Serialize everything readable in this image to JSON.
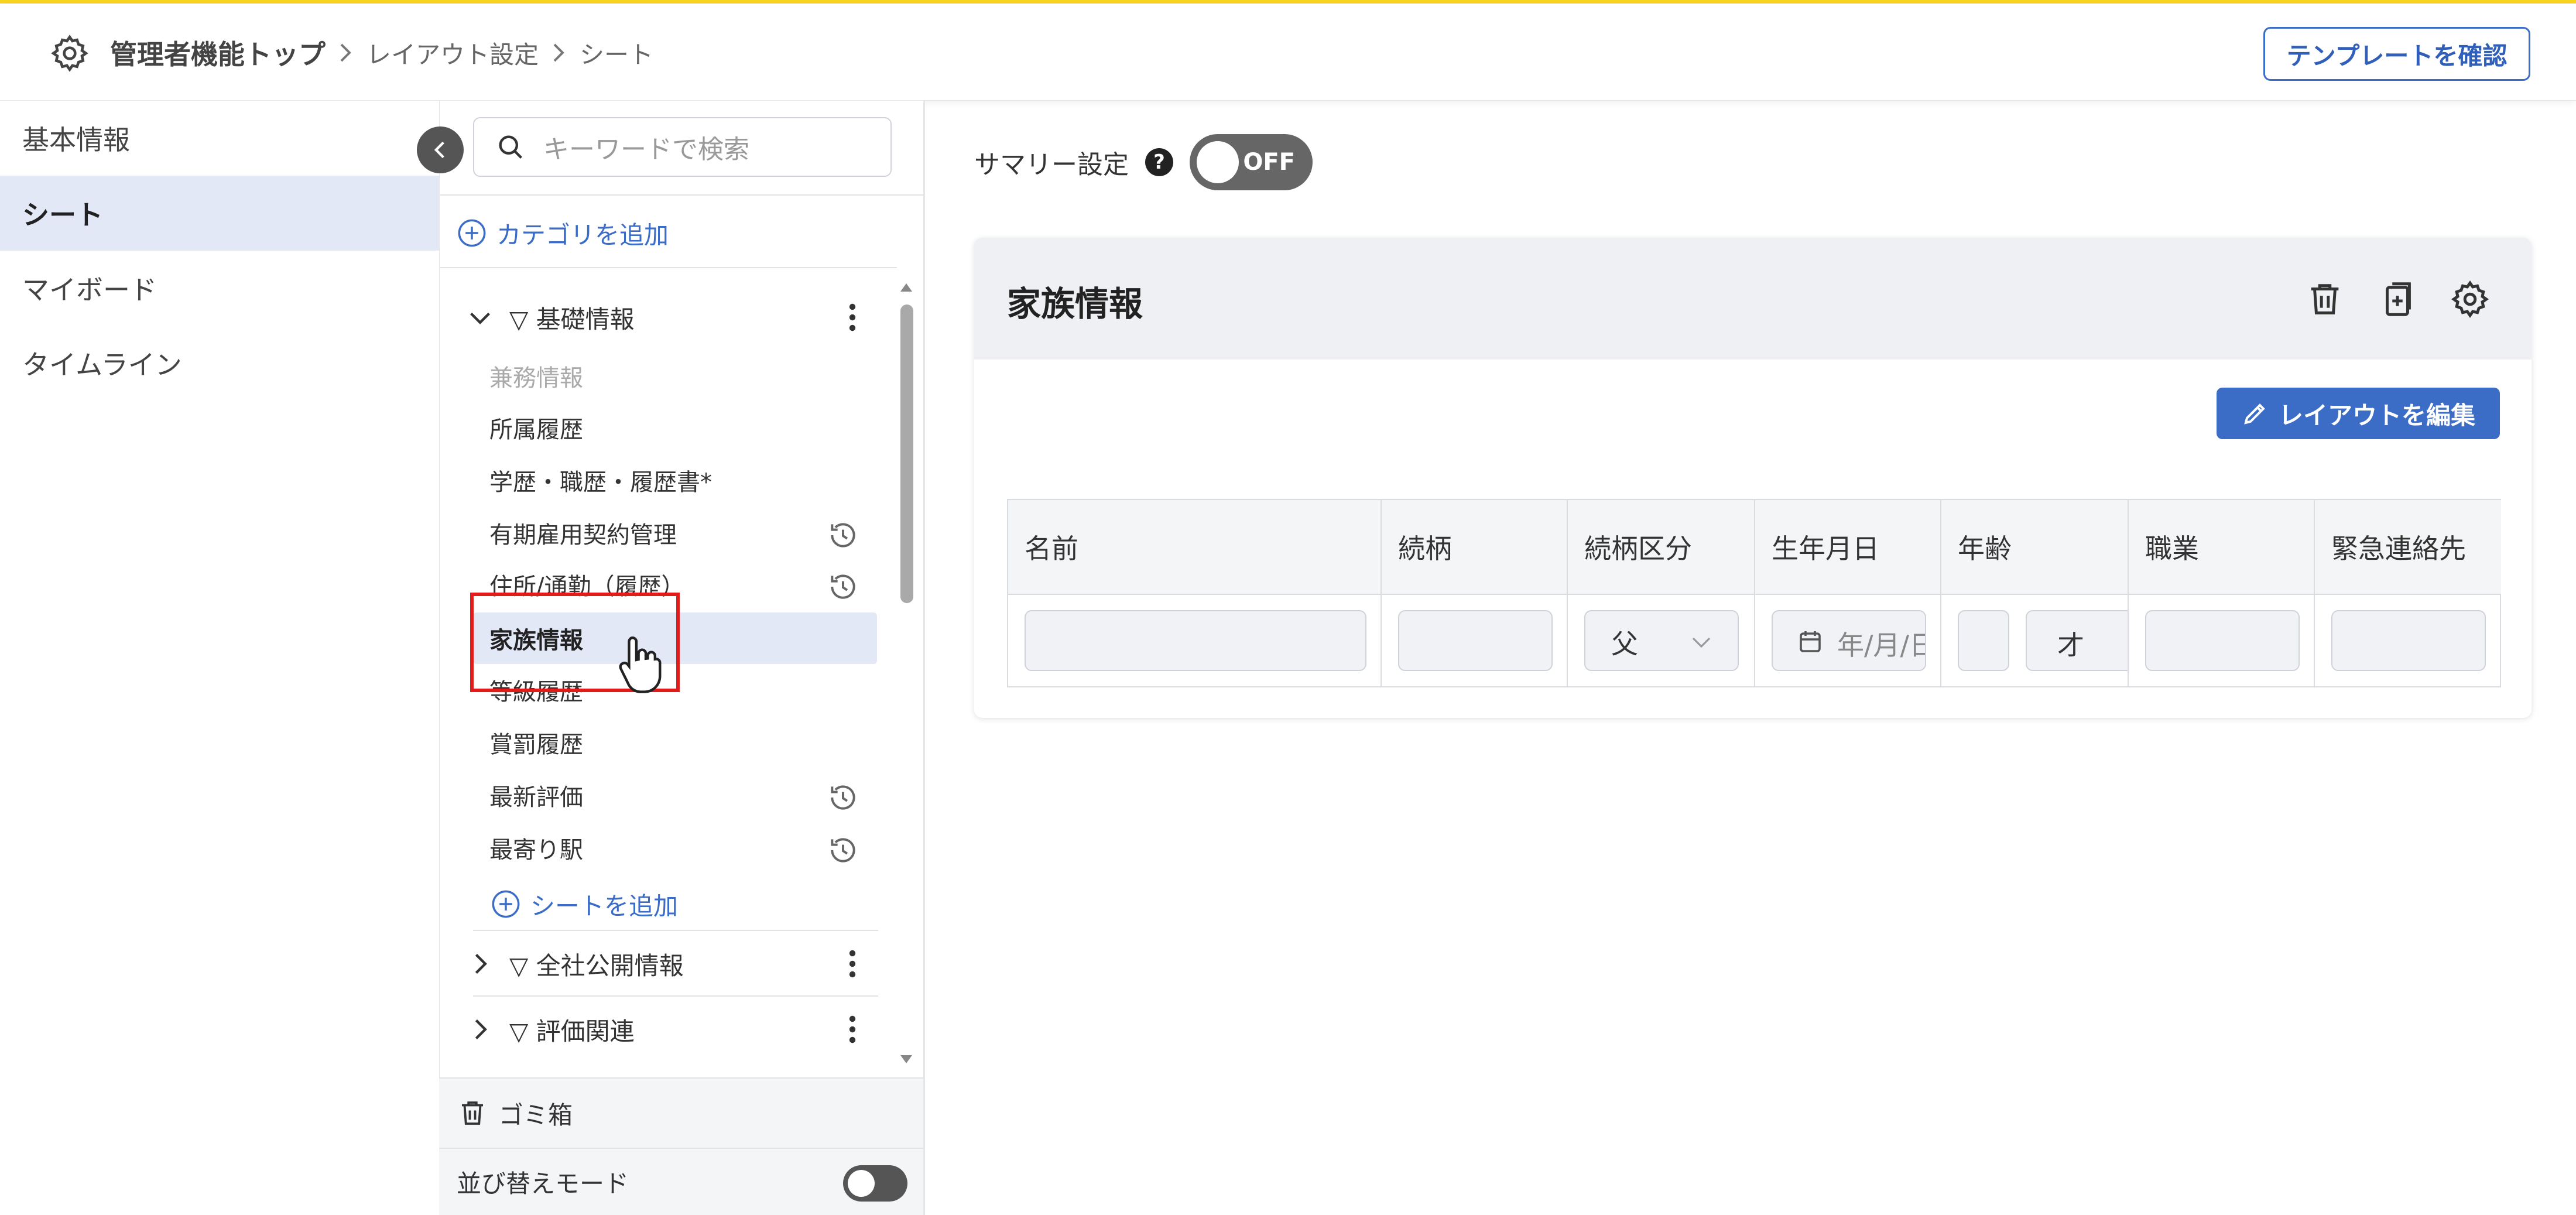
{
  "header": {
    "breadcrumb": [
      "管理者機能トップ",
      "レイアウト設定",
      "シート"
    ],
    "template_button": "テンプレートを確認"
  },
  "leftnav": {
    "items": [
      {
        "label": "基本情報",
        "active": false
      },
      {
        "label": "シート",
        "active": true
      },
      {
        "label": "マイボード",
        "active": false
      },
      {
        "label": "タイムライン",
        "active": false
      }
    ]
  },
  "sheetpanel": {
    "search_placeholder": "キーワードで検索",
    "add_category": "カテゴリを追加",
    "categories": [
      {
        "label": "▽ 基礎情報",
        "expanded": true
      },
      {
        "label": "▽ 全社公開情報",
        "expanded": false
      },
      {
        "label": "▽ 評価関連",
        "expanded": false
      }
    ],
    "sheets": [
      {
        "label": "兼務情報",
        "state": "disabled",
        "history_icon": false
      },
      {
        "label": "所属履歴",
        "state": "normal",
        "history_icon": false
      },
      {
        "label": "学歴・職歴・履歴書*",
        "state": "normal",
        "history_icon": false
      },
      {
        "label": "有期雇用契約管理",
        "state": "normal",
        "history_icon": true
      },
      {
        "label": "住所/通勤（履歴）",
        "state": "normal",
        "history_icon": true
      },
      {
        "label": "家族情報",
        "state": "selected",
        "history_icon": false
      },
      {
        "label": "等級履歴",
        "state": "normal",
        "history_icon": false
      },
      {
        "label": "賞罰履歴",
        "state": "normal",
        "history_icon": false
      },
      {
        "label": "最新評価",
        "state": "normal",
        "history_icon": true
      },
      {
        "label": "最寄り駅",
        "state": "normal",
        "history_icon": true
      }
    ],
    "add_sheet": "シートを追加",
    "trash": "ゴミ箱",
    "sort_mode": "並び替えモード"
  },
  "main": {
    "summary_label": "サマリー設定",
    "summary_toggle": "OFF",
    "card_title": "家族情報",
    "edit_layout_button": "レイアウトを編集",
    "table_headers": [
      "名前",
      "続柄",
      "続柄区分",
      "生年月日",
      "年齢",
      "職業",
      "緊急連絡先"
    ],
    "relation_select_value": "父",
    "date_placeholder": "年/月/日",
    "age_unit": "才"
  },
  "colors": {
    "accent": "#3b6cc6",
    "topline": "#f7d21e",
    "active_bg": "#e3e8f7",
    "highlight": "#e21b1b"
  }
}
